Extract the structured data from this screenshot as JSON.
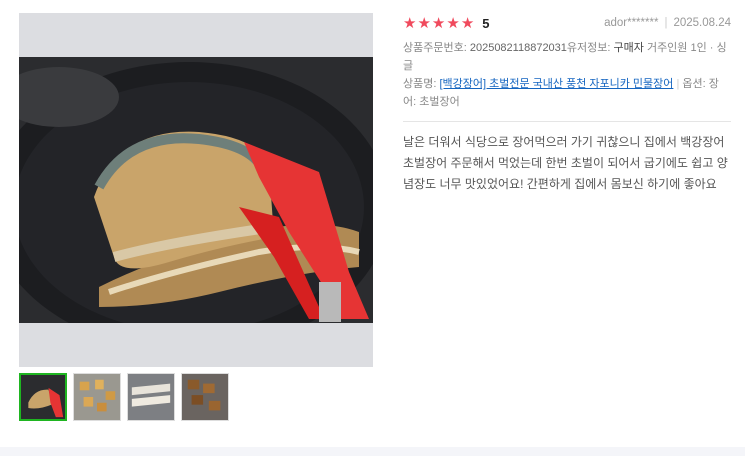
{
  "rating": {
    "score": "5",
    "stars": 5,
    "star_color": "#f04a5d"
  },
  "author": "ador*******",
  "date": "2025.08.24",
  "order_no_label": "상품주문번호: ",
  "order_no": "2025082118872031",
  "customer_label": "유저정보: ",
  "customer_value": "구매자",
  "household_label": " 거주인원 1인 · 싱글",
  "product_label": "상품명: ",
  "product_link": "[백강장어] 초벌전문 국내산 풍천 자포니카 민물장어",
  "option_label": "옵션: ",
  "option_value": "장어: 초벌장어",
  "review_text": "날은 더워서 식당으로 장어먹으러 가기 귀찮으니 집에서 백강장어 초벌장어 주문해서 먹었는데 한번 초벌이 되어서 굽기에도 쉽고 양념장도 너무 맛있었어요! 간편하게 집에서 몸보신 하기에 좋아요",
  "thumbnails": [
    {
      "name": "eel-pan-photo",
      "active": true
    },
    {
      "name": "chopped-eel-photo",
      "active": false
    },
    {
      "name": "packed-eel-photo",
      "active": false
    },
    {
      "name": "grilled-eel-photo",
      "active": false
    }
  ],
  "accent_color": "#1fb521"
}
